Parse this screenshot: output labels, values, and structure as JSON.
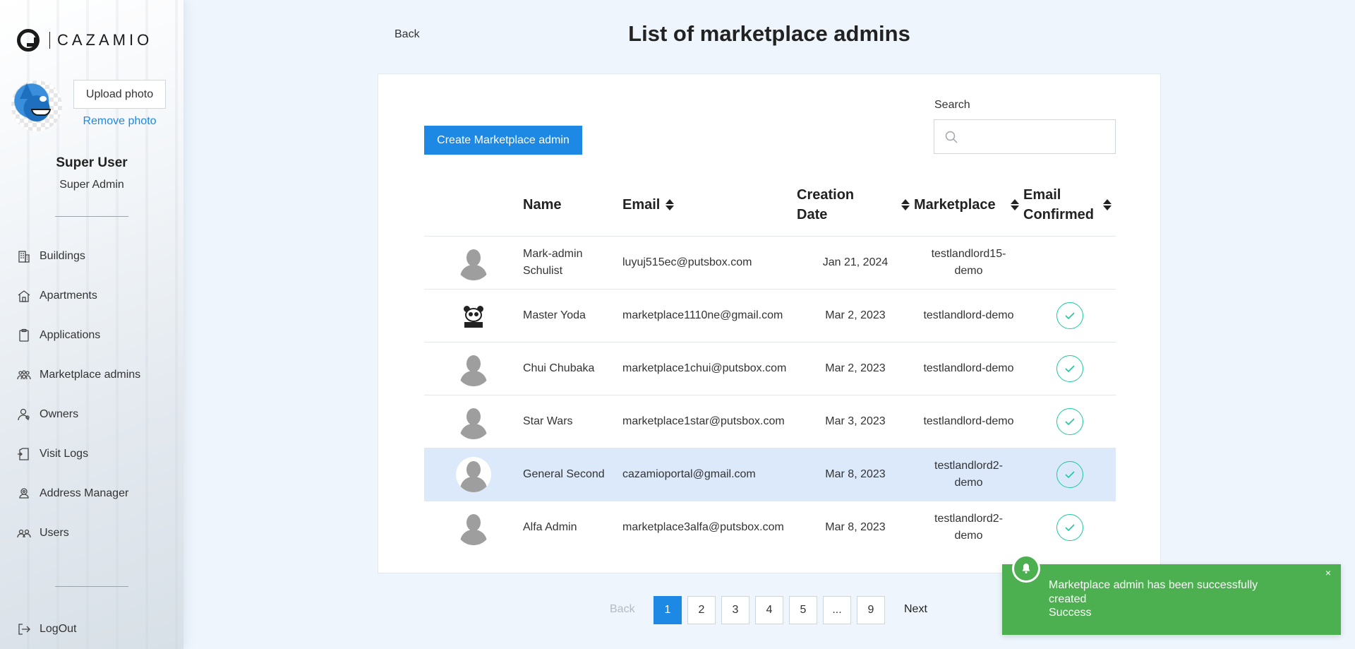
{
  "brand": {
    "name": "CAZAMIO"
  },
  "profile": {
    "upload_label": "Upload photo",
    "remove_label": "Remove photo",
    "name": "Super User",
    "role": "Super Admin"
  },
  "sidebar": {
    "items": [
      {
        "label": "Buildings",
        "icon": "building-icon"
      },
      {
        "label": "Apartments",
        "icon": "home-icon"
      },
      {
        "label": "Applications",
        "icon": "clipboard-icon"
      },
      {
        "label": "Marketplace admins",
        "icon": "group-icon"
      },
      {
        "label": "Owners",
        "icon": "owner-icon"
      },
      {
        "label": "Visit Logs",
        "icon": "door-icon"
      },
      {
        "label": "Address Manager",
        "icon": "location-icon"
      },
      {
        "label": "Users",
        "icon": "users-icon"
      }
    ],
    "logout_label": "LogOut"
  },
  "header": {
    "back_label": "Back",
    "title": "List of marketplace admins"
  },
  "toolbar": {
    "create_label": "Create Marketplace admin",
    "search_label": "Search",
    "search_value": "",
    "search_placeholder": ""
  },
  "table": {
    "columns": [
      "Name",
      "Email",
      "Creation Date",
      "Marketplace",
      "Email Confirmed"
    ],
    "rows": [
      {
        "name": "Mark-admin Schulist",
        "email": "luyuj515ec@putsbox.com",
        "date": "Jan 21, 2024",
        "marketplace": "testlandlord15-demo",
        "confirmed": false,
        "avatar": "person",
        "selected": false
      },
      {
        "name": "Master Yoda",
        "email": "marketplace1110ne@gmail.com",
        "date": "Mar 2, 2023",
        "marketplace": "testlandlord-demo",
        "confirmed": true,
        "avatar": "panda",
        "selected": false
      },
      {
        "name": "Chui Chubaka",
        "email": "marketplace1chui@putsbox.com",
        "date": "Mar 2, 2023",
        "marketplace": "testlandlord-demo",
        "confirmed": true,
        "avatar": "person",
        "selected": false
      },
      {
        "name": "Star Wars",
        "email": "marketplace1star@putsbox.com",
        "date": "Mar 3, 2023",
        "marketplace": "testlandlord-demo",
        "confirmed": true,
        "avatar": "person",
        "selected": false
      },
      {
        "name": "General Second",
        "email": "cazamioportal@gmail.com",
        "date": "Mar 8, 2023",
        "marketplace": "testlandlord2-demo",
        "confirmed": true,
        "avatar": "person",
        "selected": true
      },
      {
        "name": "Alfa Admin",
        "email": "marketplace3alfa@putsbox.com",
        "date": "Mar 8, 2023",
        "marketplace": "testlandlord2-demo",
        "confirmed": true,
        "avatar": "person",
        "selected": false
      }
    ]
  },
  "pagination": {
    "back_label": "Back",
    "next_label": "Next",
    "pages": [
      "1",
      "2",
      "3",
      "4",
      "5",
      "...",
      "9"
    ],
    "current": "1"
  },
  "toast": {
    "message": "Marketplace admin has been successfully created",
    "title": "Success",
    "close": "×"
  },
  "colors": {
    "accent": "#1e88e5",
    "success": "#4caf50",
    "check": "#1ec8a0",
    "selected_row": "#dbe9fb",
    "background": "#eef5fd"
  }
}
